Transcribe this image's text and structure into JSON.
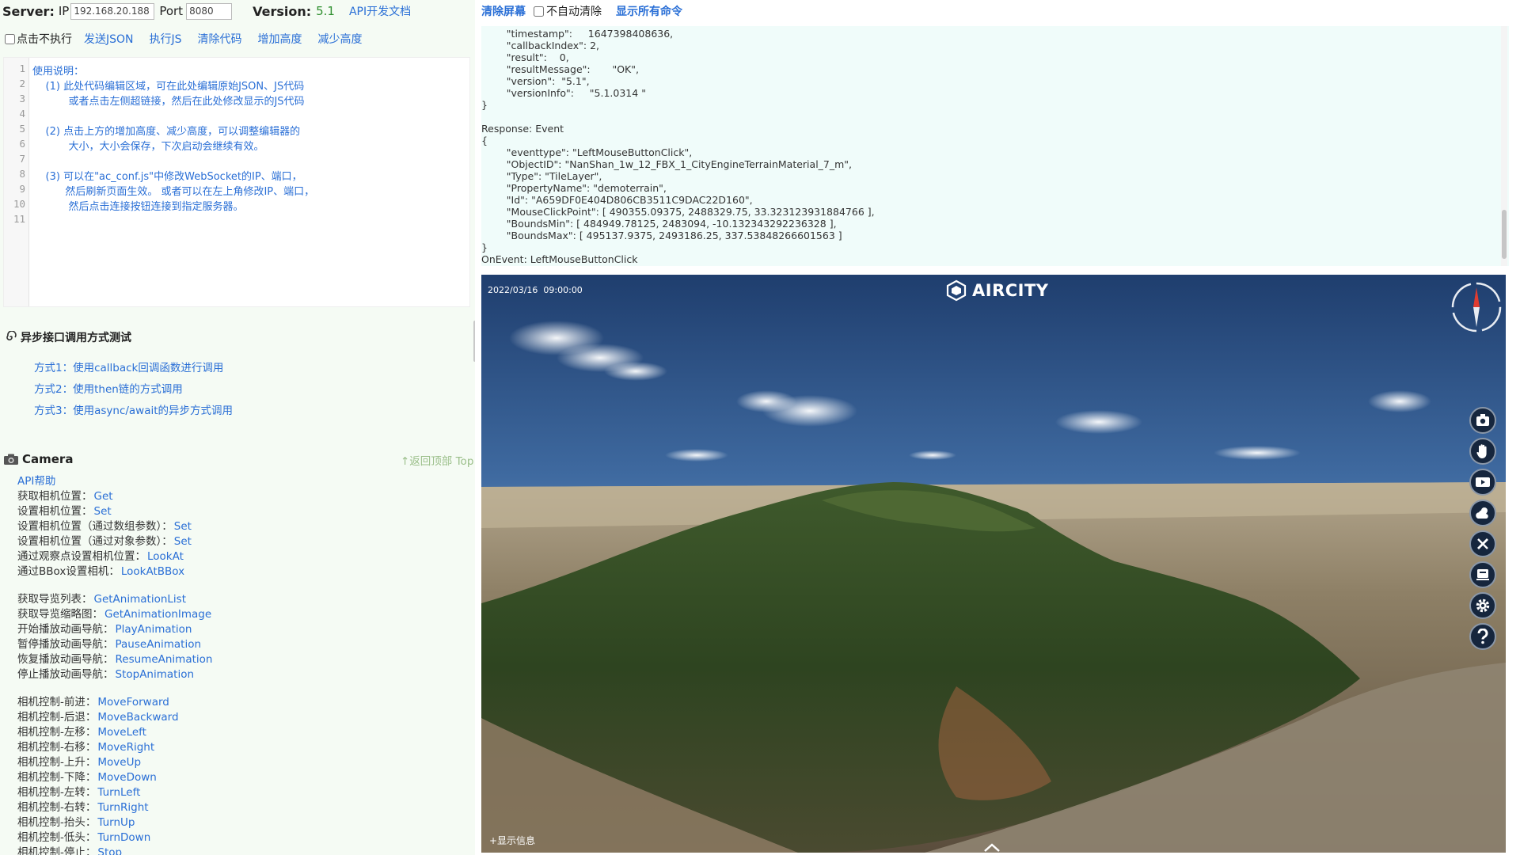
{
  "server": {
    "label": "Server:",
    "ip_label": "IP",
    "ip_value": "192.168.20.188",
    "port_label": "Port",
    "port_value": "8080",
    "version_label": "Version:",
    "version_value": "5.1",
    "api_doc_link": "API开发文档"
  },
  "toolbar": {
    "no_exec_checkbox": "点击不执行",
    "send_json": "发送JSON",
    "exec_js": "执行JS",
    "clear_code": "清除代码",
    "increase_height": "增加高度",
    "decrease_height": "减少高度"
  },
  "editor": {
    "line_numbers": [
      "1",
      "2",
      "3",
      "4",
      "5",
      "6",
      "7",
      "8",
      "9",
      "10",
      "11"
    ],
    "lines": [
      "使用说明：",
      "    (1) 此处代码编辑区域，可在此处编辑原始JSON、JS代码",
      "           或者点击左侧超链接，然后在此处修改显示的JS代码",
      "",
      "    (2) 点击上方的增加高度、减少高度，可以调整编辑器的",
      "           大小，大小会保存，下次启动会继续有效。",
      "",
      "    (3) 可以在\"ac_conf.js\"中修改WebSocket的IP、端口，",
      "          然后刷新页面生效。 或者可以在左上角修改IP、端口，",
      "           然后点击连接按钮连接到指定服务器。",
      ""
    ]
  },
  "async_section": {
    "title": "异步接口调用方式测试",
    "links": [
      "方式1：使用callback回调函数进行调用",
      "方式2：使用then链的方式调用",
      "方式3：使用async/await的异步方式调用"
    ]
  },
  "camera_section": {
    "title": "Camera",
    "back_top": "↑返回顶部 Top",
    "api_help": "API帮助",
    "rows": [
      {
        "label": "获取相机位置：",
        "method": "Get"
      },
      {
        "label": "设置相机位置：",
        "method": "Set"
      },
      {
        "label": "设置相机位置（通过数组参数）：",
        "method": "Set"
      },
      {
        "label": "设置相机位置（通过对象参数）：",
        "method": "Set"
      },
      {
        "label": "通过观察点设置相机位置：",
        "method": "LookAt"
      },
      {
        "label": "通过BBox设置相机：",
        "method": "LookAtBBox"
      },
      {
        "label": "获取导览列表：",
        "method": "GetAnimationList"
      },
      {
        "label": "获取导览缩略图：",
        "method": "GetAnimationImage"
      },
      {
        "label": "开始播放动画导航：",
        "method": "PlayAnimation"
      },
      {
        "label": "暂停播放动画导航：",
        "method": "PauseAnimation"
      },
      {
        "label": "恢复播放动画导航：",
        "method": "ResumeAnimation"
      },
      {
        "label": "停止播放动画导航：",
        "method": "StopAnimation"
      },
      {
        "label": "相机控制-前进：",
        "method": "MoveForward"
      },
      {
        "label": "相机控制-后退：",
        "method": "MoveBackward"
      },
      {
        "label": "相机控制-左移：",
        "method": "MoveLeft"
      },
      {
        "label": "相机控制-右移：",
        "method": "MoveRight"
      },
      {
        "label": "相机控制-上升：",
        "method": "MoveUp"
      },
      {
        "label": "相机控制-下降：",
        "method": "MoveDown"
      },
      {
        "label": "相机控制-左转：",
        "method": "TurnLeft"
      },
      {
        "label": "相机控制-右转：",
        "method": "TurnRight"
      },
      {
        "label": "相机控制-抬头：",
        "method": "TurnUp"
      },
      {
        "label": "相机控制-低头：",
        "method": "TurnDown"
      },
      {
        "label": "相机控制-停止：",
        "method": "Stop"
      }
    ]
  },
  "right_bar": {
    "clear_screen": "清除屏幕",
    "no_auto_clear": "不自动清除",
    "show_all_commands": "显示所有命令"
  },
  "log": {
    "lines": [
      "        \"timestamp\":     1647398408636,",
      "        \"callbackIndex\": 2,",
      "        \"result\":    0,",
      "        \"resultMessage\":       \"OK\",",
      "        \"version\":  \"5.1\",",
      "        \"versionInfo\":     \"5.1.0314 \"",
      "}",
      "",
      "Response: Event",
      "{",
      "        \"eventtype\": \"LeftMouseButtonClick\",",
      "        \"ObjectID\": \"NanShan_1w_12_FBX_1_CityEngineTerrainMaterial_7_m\",",
      "        \"Type\": \"TileLayer\",",
      "        \"PropertyName\": \"demoterrain\",",
      "        \"Id\": \"A659DF0E404D806CB3511C9DAC22D160\",",
      "        \"MouseClickPoint\": [ 490355.09375, 2488329.75, 33.323123931884766 ],",
      "        \"BoundsMin\": [ 484949.78125, 2483094, -10.132343292236328 ],",
      "        \"BoundsMax\": [ 495137.9375, 2493186.25, 337.53848266601563 ]",
      "}",
      "OnEvent: LeftMouseButtonClick"
    ]
  },
  "viewport": {
    "date": "2022/03/16",
    "time": "09:00:00",
    "logo_text": "AIRCITY",
    "show_info": "+显示信息",
    "tool_icons": [
      "camera-icon",
      "hand-icon",
      "video-icon",
      "weather-icon",
      "measure-icon",
      "layers-icon",
      "settings-icon",
      "help-icon"
    ]
  }
}
